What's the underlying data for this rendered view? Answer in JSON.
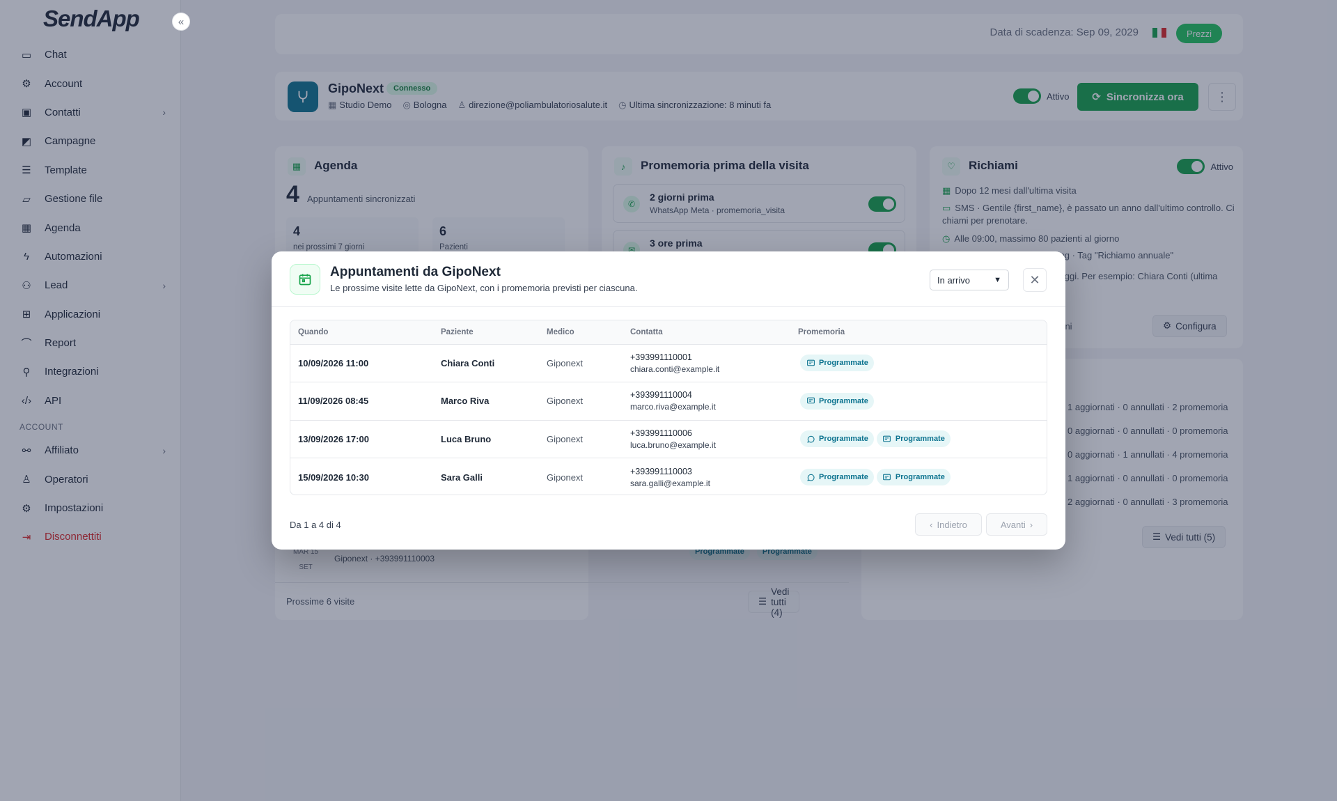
{
  "app": {
    "logo": "SendApp",
    "collapse_glyph": "«"
  },
  "sidebar": {
    "items": [
      {
        "label": "Chat",
        "icon": "chat-icon",
        "chevron": false
      },
      {
        "label": "Account",
        "icon": "gear-icon",
        "chevron": false
      },
      {
        "label": "Contatti",
        "icon": "contacts-icon",
        "chevron": true
      },
      {
        "label": "Campagne",
        "icon": "megaphone-icon",
        "chevron": false
      },
      {
        "label": "Template",
        "icon": "template-icon",
        "chevron": false
      },
      {
        "label": "Gestione file",
        "icon": "folder-icon",
        "chevron": false
      },
      {
        "label": "Agenda",
        "icon": "calendar-icon",
        "chevron": false
      },
      {
        "label": "Automazioni",
        "icon": "lightning-icon",
        "chevron": false
      },
      {
        "label": "Lead",
        "icon": "users-icon",
        "chevron": true
      },
      {
        "label": "Applicazioni",
        "icon": "apps-icon",
        "chevron": false
      },
      {
        "label": "Report",
        "icon": "chart-icon",
        "chevron": false
      },
      {
        "label": "Integrazioni",
        "icon": "plug-icon",
        "chevron": false
      },
      {
        "label": "API",
        "icon": "code-icon",
        "chevron": false
      }
    ],
    "section_account": "ACCOUNT",
    "account_items": [
      {
        "label": "Affiliato",
        "icon": "share-icon",
        "chevron": true
      },
      {
        "label": "Operatori",
        "icon": "user-icon",
        "chevron": false
      },
      {
        "label": "Impostazioni",
        "icon": "settings-icon",
        "chevron": false
      }
    ],
    "logout": "Disconnettiti"
  },
  "topbar": {
    "due_date": "Data di scadenza: Sep 09, 2029",
    "price_button": "Prezzi"
  },
  "integration": {
    "name": "GipoNext",
    "status": "Connesso",
    "studio": "Studio Demo",
    "city": "Bologna",
    "email": "direzione@poliambulatoriosalute.it",
    "last_sync": "Ultima sincronizzazione: 8 minuti fa",
    "active_label": "Attivo",
    "sync_button": "Sincronizza ora"
  },
  "agenda_card": {
    "title": "Agenda",
    "count": "4",
    "count_label": "Appuntamenti sincronizzati",
    "stat1_value": "4",
    "stat1_label": "nei prossimi 7 giorni",
    "stat2_value": "6",
    "stat2_label": "Pazienti",
    "row_day": "MAR 15",
    "row_month": "SET",
    "row_info": "Giponext · +393991110003",
    "row_badge": "Programmate",
    "footer": "Prossime 6 visite",
    "view_all": "Vedi tutti (4)"
  },
  "promemoria_card": {
    "title": "Promemoria prima della visita",
    "items": [
      {
        "title": "2 giorni prima",
        "subtitle": "WhatsApp Meta · promemoria_visita"
      },
      {
        "title": "3 ore prima",
        "subtitle": ""
      }
    ]
  },
  "richiami_card": {
    "title": "Richiami",
    "active_label": "Attivo",
    "lines": [
      "Dopo 12 mesi dall'ultima visita",
      "SMS · Gentile {first_name}, è passato un anno dall'ultimo controllo. Ci chiami per prenotare.",
      "Alle 09:00, massimo 80 pazienti al giorno",
      "ting · Tag \"Richiamo annuale\"",
      "i oggi. Per esempio: Chiara Conti (ultima"
    ],
    "partial": "iorni",
    "configure": "Configura"
  },
  "sync_log": {
    "lines": [
      "1 aggiornati · 0 annullati · 2 promemoria",
      "0 aggiornati · 0 annullati · 0 promemoria",
      "0 aggiornati · 1 annullati · 4 promemoria",
      "1 aggiornati · 0 annullati · 0 promemoria",
      "2 aggiornati · 0 annullati · 3 promemoria"
    ],
    "view_all": "Vedi tutti (5)"
  },
  "modal": {
    "title": "Appuntamenti da GipoNext",
    "subtitle": "Le prossime visite lette da GipoNext, con i promemoria previsti per ciascuna.",
    "filter_value": "In arrivo",
    "columns": [
      "Quando",
      "Paziente",
      "Medico",
      "Contatta",
      "Promemoria"
    ],
    "rows": [
      {
        "when": "10/09/2026 11:00",
        "patient": "Chiara Conti",
        "doctor": "Giponext",
        "phone": "+393991110001",
        "email": "chiara.conti@example.it",
        "badges": [
          {
            "type": "sms",
            "label": "Programmate"
          }
        ]
      },
      {
        "when": "11/09/2026 08:45",
        "patient": "Marco Riva",
        "doctor": "Giponext",
        "phone": "+393991110004",
        "email": "marco.riva@example.it",
        "badges": [
          {
            "type": "sms",
            "label": "Programmate"
          }
        ]
      },
      {
        "when": "13/09/2026 17:00",
        "patient": "Luca Bruno",
        "doctor": "Giponext",
        "phone": "+393991110006",
        "email": "luca.bruno@example.it",
        "badges": [
          {
            "type": "whatsapp",
            "label": "Programmate"
          },
          {
            "type": "sms",
            "label": "Programmate"
          }
        ]
      },
      {
        "when": "15/09/2026 10:30",
        "patient": "Sara Galli",
        "doctor": "Giponext",
        "phone": "+393991110003",
        "email": "sara.galli@example.it",
        "badges": [
          {
            "type": "whatsapp",
            "label": "Programmate"
          },
          {
            "type": "sms",
            "label": "Programmate"
          }
        ]
      }
    ],
    "pager_text": "Da 1 a 4 di 4",
    "prev": "Indietro",
    "next": "Avanti"
  },
  "colors": {
    "primary": "#16a34a",
    "badge_bg": "#e6f6f7",
    "badge_fg": "#0e7490",
    "danger": "#dc2626",
    "overlay": "rgba(30,41,72,0.42)"
  }
}
